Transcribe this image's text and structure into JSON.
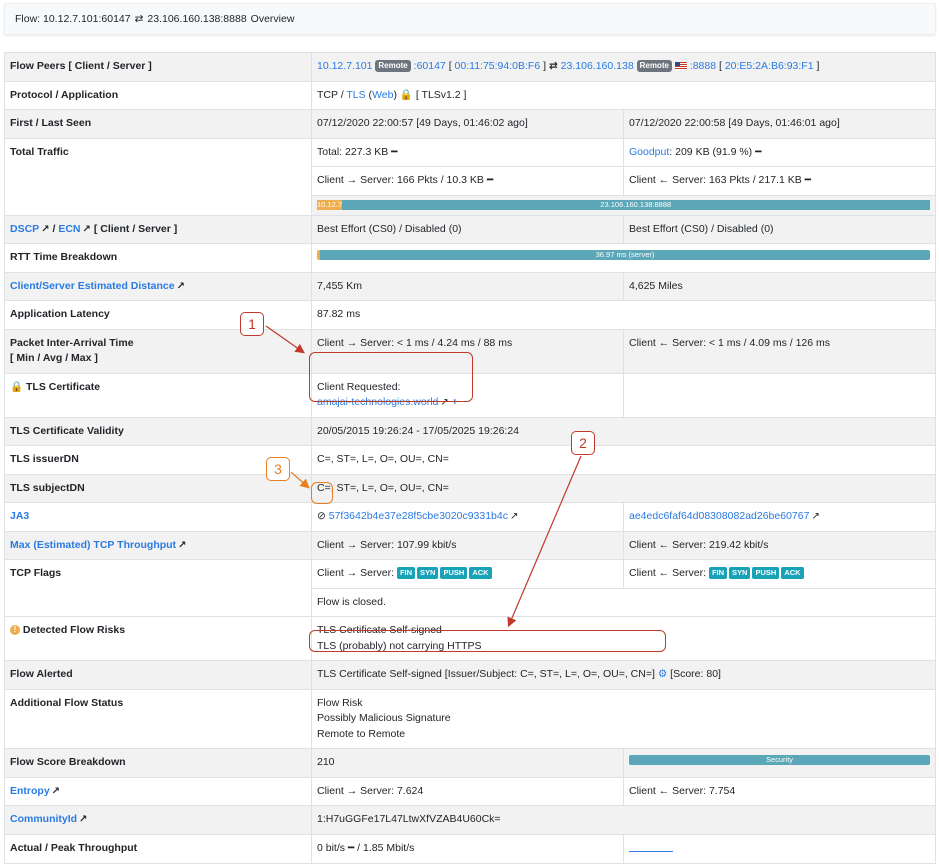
{
  "topbar": {
    "flow_label": "Flow: 10.12.7.101:60147",
    "arrow": "⇄",
    "dest": "23.106.160.138:8888",
    "tab": "Overview"
  },
  "rows": {
    "peers": {
      "label": "Flow Peers [ Client / Server ]",
      "client_ip": "10.12.7.101",
      "remote_badge": "Remote",
      "client_port": ":60147",
      "client_mac": "00:11:75:94:0B:F6",
      "arrow": "⇄",
      "server_ip": "23.106.160.138",
      "server_port": ":8888",
      "server_mac": "20:E5:2A:B6:93:F1"
    },
    "protocol": {
      "label": "Protocol / Application",
      "value_prefix": "TCP / ",
      "tls": "TLS",
      "web": "Web",
      "suffix": "[ TLSv1.2 ]"
    },
    "seen": {
      "label": "First / Last Seen",
      "first": "07/12/2020 22:00:57 [49 Days, 01:46:02 ago]",
      "last": "07/12/2020 22:00:58 [49 Days, 01:46:01 ago]"
    },
    "traffic": {
      "label": "Total Traffic",
      "total": "Total: 227.3 KB ━",
      "goodput_label": "Goodput",
      "goodput_value": ": 209 KB (91.9 %) ━",
      "c2s": "Client → Server: 166 Pkts / 10.3 KB ━",
      "s2c": "Client ← Server: 163 Pkts / 217.1 KB ━",
      "bar_client": "10.12.7.1",
      "bar_server": "23.106.160.138:8888"
    },
    "dscp": {
      "label_dscp": "DSCP",
      "label_ecn": "ECN",
      "label_rest": "[ Client / Server ]",
      "client": "Best Effort (CS0) / Disabled (0)",
      "server": "Best Effort (CS0) / Disabled (0)"
    },
    "rtt": {
      "label": "RTT Time Breakdown",
      "bar": "36.97 ms (server)"
    },
    "distance": {
      "label": "Client/Server Estimated Distance",
      "km": "7,455 Km",
      "miles": "4,625 Miles"
    },
    "latency": {
      "label": "Application Latency",
      "value": "87.82 ms"
    },
    "iat": {
      "label_1": "Packet Inter-Arrival Time",
      "label_2": "[ Min / Avg / Max ]",
      "c2s": "Client → Server: < 1 ms / 4.24 ms / 88 ms",
      "s2c": "Client ← Server: < 1 ms / 4.09 ms / 126 ms"
    },
    "cert": {
      "label": "TLS Certificate",
      "requested": "Client Requested:",
      "host": "amajai-technologies.world"
    },
    "validity": {
      "label": "TLS Certificate Validity",
      "value": "20/05/2015 19:26:24 - 17/05/2025 19:26:24"
    },
    "issuer": {
      "label": "TLS issuerDN",
      "value": "C=, ST=, L=, O=, OU=, CN="
    },
    "subject": {
      "label": "TLS subjectDN",
      "value": "C=, ST=, L=, O=, OU=, CN="
    },
    "ja3": {
      "label": "JA3",
      "client": "57f3642b4e37e28f5cbe3020c9331b4c",
      "server": "ae4edc6faf64d08308082ad26be60767"
    },
    "throughput": {
      "label": "Max (Estimated) TCP Throughput",
      "c2s": "Client → Server: 107.99 kbit/s",
      "s2c": "Client ← Server: 219.42 kbit/s"
    },
    "flags": {
      "label": "TCP Flags",
      "c2s_prefix": "Client → Server:",
      "s2c_prefix": "Client ← Server:",
      "c2s_flags": [
        "FIN",
        "SYN",
        "PUSH",
        "ACK"
      ],
      "s2c_flags": [
        "FIN",
        "SYN",
        "PUSH",
        "ACK"
      ],
      "closed": "Flow is closed."
    },
    "risks": {
      "label": "Detected Flow Risks",
      "r1": "TLS Certificate Self-signed",
      "r2": "TLS (probably) not carrying HTTPS"
    },
    "alerted": {
      "label": "Flow Alerted",
      "value": "TLS Certificate Self-signed [Issuer/Subject: C=, ST=, L=, O=, OU=, CN=]",
      "score": "[Score: 80]"
    },
    "status": {
      "label": "Additional Flow Status",
      "s1": "Flow Risk",
      "s2": "Possibly Malicious Signature",
      "s3": "Remote to Remote"
    },
    "score": {
      "label": "Flow Score Breakdown",
      "value": "210",
      "bar": "Security"
    },
    "entropy": {
      "label": "Entropy",
      "c2s": "Client → Server: 7.624",
      "s2c": "Client ← Server: 7.754"
    },
    "community": {
      "label": "CommunityId",
      "value": "1:H7uGGFe17L47LtwXfVZAB4U60Ck="
    },
    "actual": {
      "label": "Actual / Peak Throughput",
      "value": "0 bit/s ━ / 1.85 Mbit/s"
    }
  },
  "annotations": {
    "n1": "1",
    "n2": "2",
    "n3": "3"
  },
  "colors": {
    "link": "#2a7ae2",
    "annotation": "#c0392b",
    "annotation_alt": "#e67e22",
    "bar": "#5ba7b8",
    "bar_accent": "#f0ad4e"
  }
}
